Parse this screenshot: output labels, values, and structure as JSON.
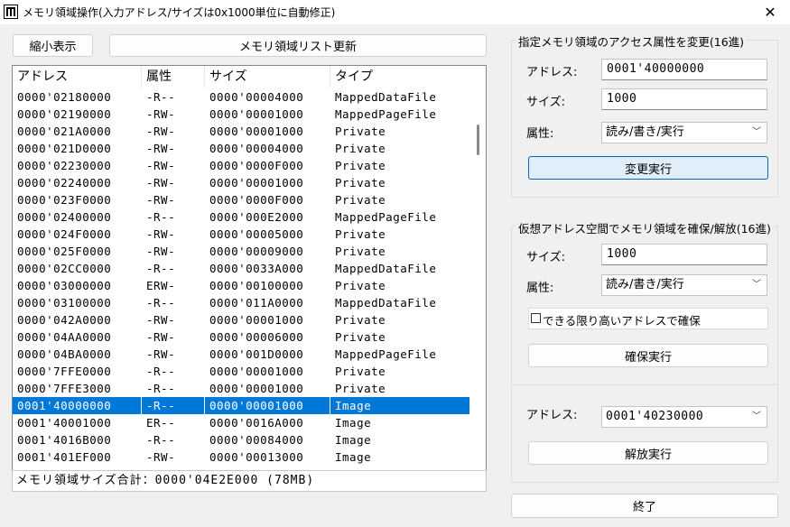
{
  "window": {
    "title": "メモリ領域操作(入力アドレス/サイズは0x1000単位に自動修正)",
    "close_glyph": "✕"
  },
  "toolbar": {
    "shrink_label": "縮小表示",
    "refresh_label": "メモリ領域リスト更新"
  },
  "list": {
    "columns": [
      "アドレス",
      "属性",
      "サイズ",
      "タイプ"
    ],
    "rows": [
      [
        "0000'02180000",
        "-R--",
        "0000'00004000",
        "MappedDataFile"
      ],
      [
        "0000'02190000",
        "-RW-",
        "0000'00001000",
        "MappedPageFile"
      ],
      [
        "0000'021A0000",
        "-RW-",
        "0000'00001000",
        "Private"
      ],
      [
        "0000'021D0000",
        "-RW-",
        "0000'00004000",
        "Private"
      ],
      [
        "0000'02230000",
        "-RW-",
        "0000'0000F000",
        "Private"
      ],
      [
        "0000'02240000",
        "-RW-",
        "0000'00001000",
        "Private"
      ],
      [
        "0000'023F0000",
        "-RW-",
        "0000'0000F000",
        "Private"
      ],
      [
        "0000'02400000",
        "-R--",
        "0000'000E2000",
        "MappedPageFile"
      ],
      [
        "0000'024F0000",
        "-RW-",
        "0000'00005000",
        "Private"
      ],
      [
        "0000'025F0000",
        "-RW-",
        "0000'00009000",
        "Private"
      ],
      [
        "0000'02CC0000",
        "-R--",
        "0000'0033A000",
        "MappedDataFile"
      ],
      [
        "0000'03000000",
        "ERW-",
        "0000'00100000",
        "Private"
      ],
      [
        "0000'03100000",
        "-R--",
        "0000'011A0000",
        "MappedDataFile"
      ],
      [
        "0000'042A0000",
        "-RW-",
        "0000'00001000",
        "Private"
      ],
      [
        "0000'04AA0000",
        "-RW-",
        "0000'00006000",
        "Private"
      ],
      [
        "0000'04BA0000",
        "-RW-",
        "0000'001D0000",
        "MappedPageFile"
      ],
      [
        "0000'7FFE0000",
        "-R--",
        "0000'00001000",
        "Private"
      ],
      [
        "0000'7FFE3000",
        "-R--",
        "0000'00001000",
        "Private"
      ],
      [
        "0001'40000000",
        "-R--",
        "0000'00001000",
        "Image"
      ],
      [
        "0001'40001000",
        "ER--",
        "0000'0016A000",
        "Image"
      ],
      [
        "0001'4016B000",
        "-R--",
        "0000'00084000",
        "Image"
      ],
      [
        "0001'401EF000",
        "-RW-",
        "0000'00013000",
        "Image"
      ]
    ],
    "selected_index": 18
  },
  "status": {
    "total_label": "メモリ領域サイズ合計：0000'04E2E000 (78MB)"
  },
  "protect_group": {
    "title": "指定メモリ領域のアクセス属性を変更(16進)",
    "address_label": "アドレス:",
    "address_value": "0001'40000000",
    "size_label": "サイズ:",
    "size_value": "1000",
    "attr_label": "属性:",
    "attr_value": "読み/書き/実行",
    "execute_label": "変更実行"
  },
  "alloc_group": {
    "title": "仮想アドレス空間でメモリ領域を確保/解放(16進)",
    "size_label": "サイズ:",
    "size_value": "1000",
    "attr_label": "属性:",
    "attr_value": "読み/書き/実行",
    "high_address_label": "できる限り高いアドレスで確保",
    "high_address_checked": false,
    "alloc_label": "確保実行",
    "address_label": "アドレス:",
    "address_value": "0001'40230000",
    "free_label": "解放実行"
  },
  "footer": {
    "exit_label": "終了"
  },
  "colors": {
    "selection": "#0078d7",
    "accent_border": "#0067c0",
    "active_button": "#e0eef9"
  }
}
